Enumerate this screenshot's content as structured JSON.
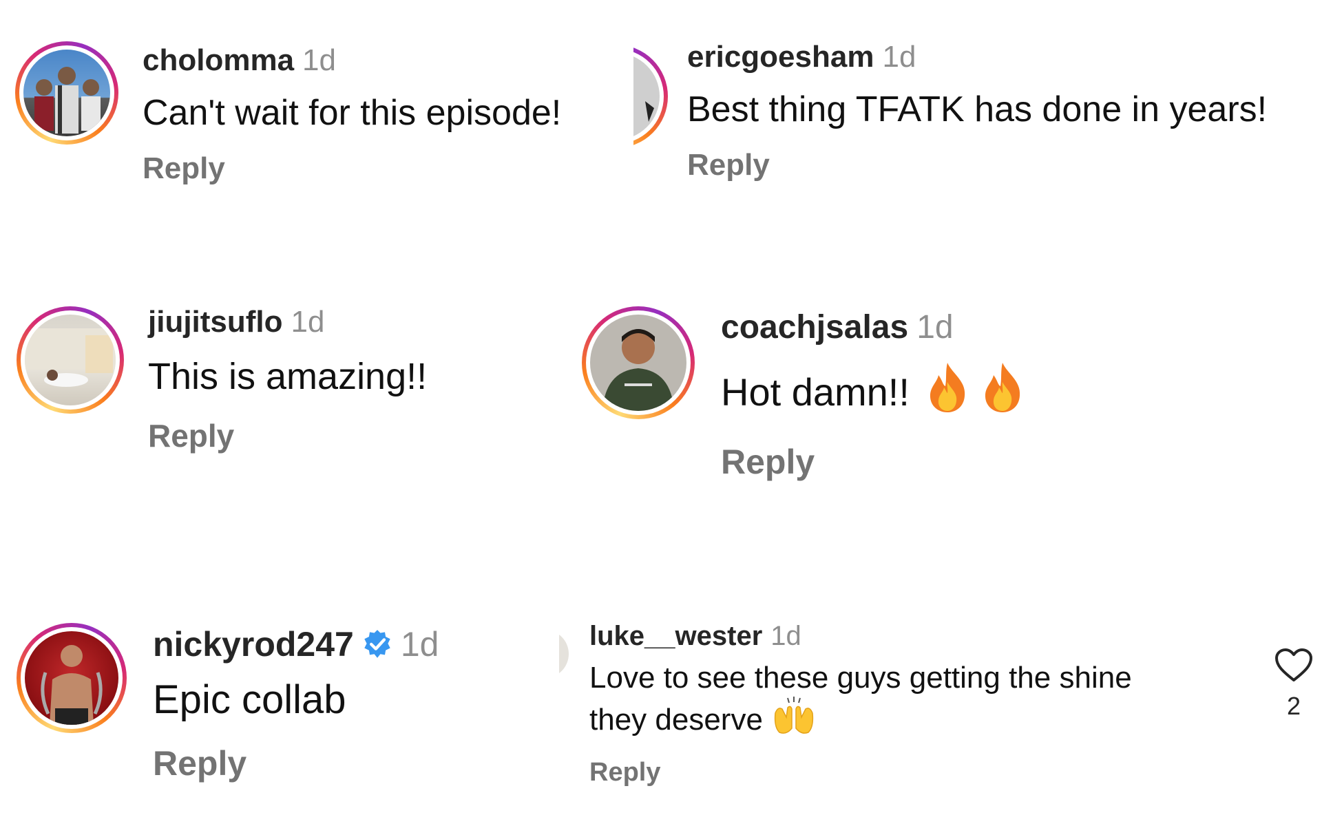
{
  "comments": [
    {
      "username": "cholomma",
      "time": "1d",
      "text": "Can't wait for this episode!",
      "reply": "Reply"
    },
    {
      "username": "ericgoesham",
      "time": "1d",
      "text": "Best thing TFATK has done in years!",
      "reply": "Reply"
    },
    {
      "username": "jiujitsuflo",
      "time": "1d",
      "text": "This is amazing!!",
      "reply": "Reply"
    },
    {
      "username": "coachjsalas",
      "time": "1d",
      "text": "Hot damn!!",
      "emojis": [
        "fire-emoji",
        "fire-emoji"
      ],
      "reply": "Reply"
    },
    {
      "username": "nickyrod247",
      "time": "1d",
      "text": "Epic collab",
      "verified": true,
      "reply": "Reply"
    },
    {
      "username": "luke__wester",
      "time": "1d",
      "text_line1": "Love to see these guys getting the shine",
      "text_line2": "they deserve",
      "emoji": "raising-hands-emoji",
      "reply": "Reply",
      "like_count": "2"
    }
  ],
  "colors": {
    "username": "#262626",
    "meta_gray": "#8e8e8e",
    "reply_gray": "#737373",
    "verified_blue": "#3897f0",
    "story_ring": [
      "#feda75",
      "#fa7e1e",
      "#d62976",
      "#962fbf"
    ]
  }
}
